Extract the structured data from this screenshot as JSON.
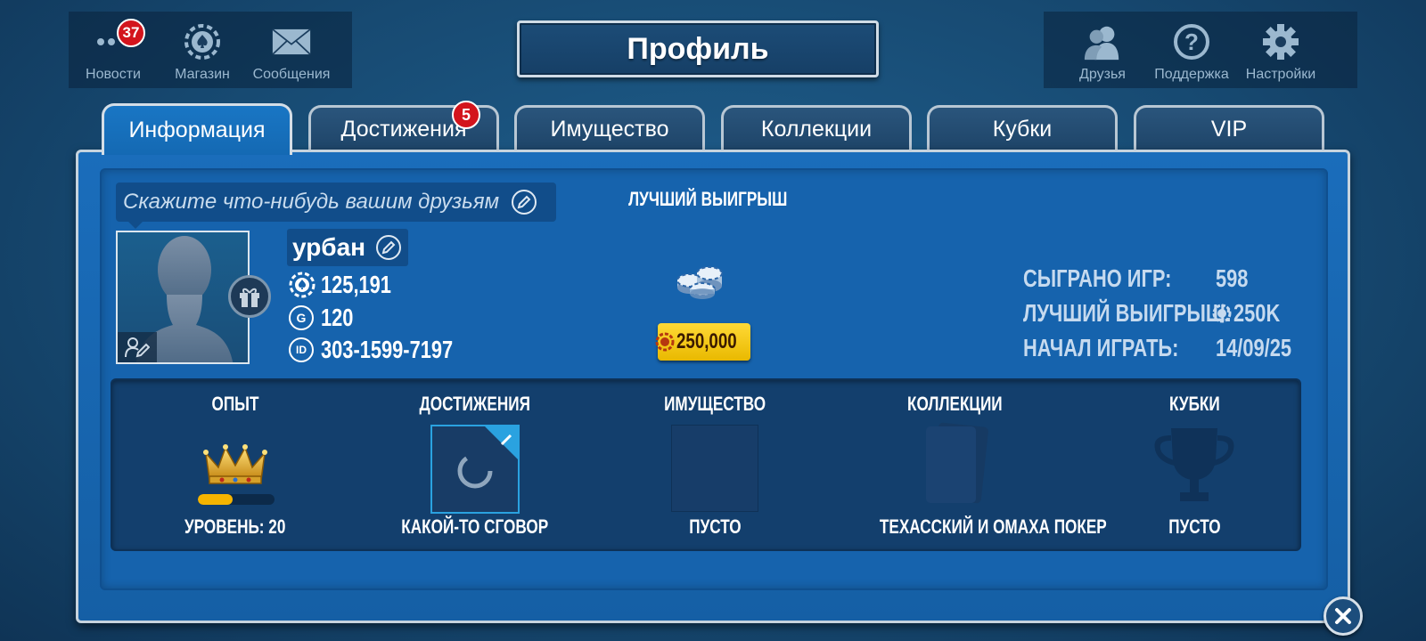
{
  "top_left": {
    "items": [
      {
        "label": "Новости",
        "badge": "37"
      },
      {
        "label": "Магазин"
      },
      {
        "label": "Сообщения"
      }
    ]
  },
  "top_right": {
    "items": [
      {
        "label": "Друзья"
      },
      {
        "label": "Поддержка"
      },
      {
        "label": "Настройки"
      }
    ]
  },
  "title": "Профиль",
  "tabs": [
    {
      "label": "Информация",
      "active": true
    },
    {
      "label": "Достижения",
      "badge": "5"
    },
    {
      "label": "Имущество"
    },
    {
      "label": "Коллекции"
    },
    {
      "label": "Кубки"
    },
    {
      "label": "VIP"
    }
  ],
  "profile": {
    "status_placeholder": "Скажите что-нибудь вашим друзьям",
    "name": "урбан",
    "chips": "125,191",
    "gold": "120",
    "gold_icon_letter": "G",
    "id_icon_text": "ID",
    "id": "303-1599-7197"
  },
  "best_win": {
    "title": "ЛУЧШИЙ ВЫИГРЫШ",
    "amount": "250,000"
  },
  "stats": [
    {
      "key": "СЫГРАНО ИГР:",
      "value": "598"
    },
    {
      "key": "ЛУЧШИЙ ВЫИГРЫШ:",
      "value": "250K"
    },
    {
      "key": "НАЧАЛ ИГРАТЬ:",
      "value": "14/09/25"
    }
  ],
  "bottom": [
    {
      "head": "ОПЫТ",
      "foot": "УРОВЕНЬ: 20",
      "progress": 0.45
    },
    {
      "head": "ДОСТИЖЕНИЯ",
      "foot": "КАКОЙ-ТО СГОВОР"
    },
    {
      "head": "ИМУЩЕСТВО",
      "foot": "ПУСТО"
    },
    {
      "head": "КОЛЛЕКЦИИ",
      "foot": "ТЕХАССКИЙ И ОМАХА ПОКЕР"
    },
    {
      "head": "КУБКИ",
      "foot": "ПУСТО"
    }
  ],
  "colors": {
    "accent_blue": "#1669b3",
    "badge_red": "#d3141c",
    "gold": "#ffd936",
    "xp_bar": "#f5b400"
  }
}
